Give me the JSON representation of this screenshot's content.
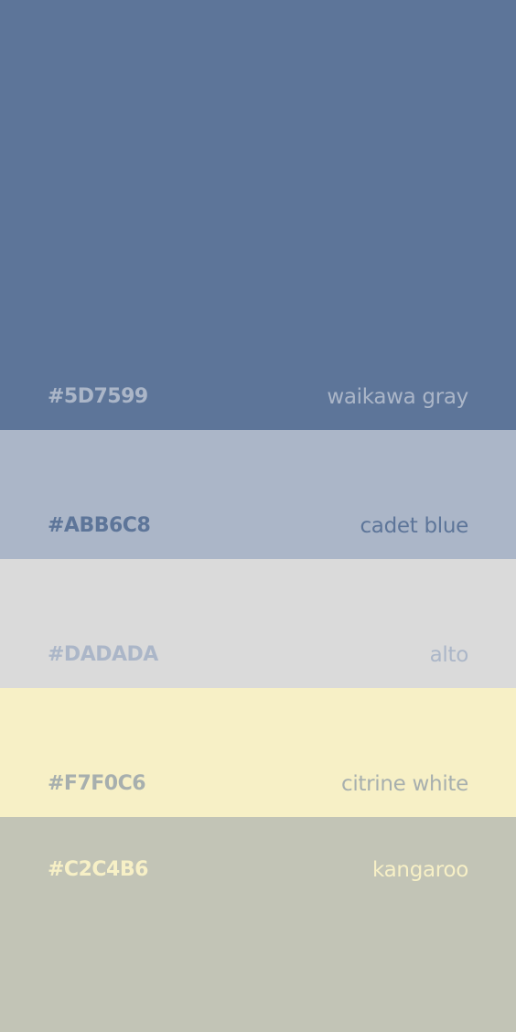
{
  "palette": [
    {
      "hex": "#5D7599",
      "name": "waikawa gray",
      "color": "#5D7599",
      "text_color": "#ABB6C8"
    },
    {
      "hex": "#ABB6C8",
      "name": "cadet blue",
      "color": "#ABB6C8",
      "text_color": "#5D7599"
    },
    {
      "hex": "#DADADA",
      "name": "alto",
      "color": "#DADADA",
      "text_color": "#ABB6C8"
    },
    {
      "hex": "#F7F0C6",
      "name": "citrine white",
      "color": "#F7F0C6",
      "text_color": "#A7AFAE"
    },
    {
      "hex": "#C2C4B6",
      "name": "kangaroo",
      "color": "#C2C4B6",
      "text_color": "#F7F0C6"
    }
  ]
}
